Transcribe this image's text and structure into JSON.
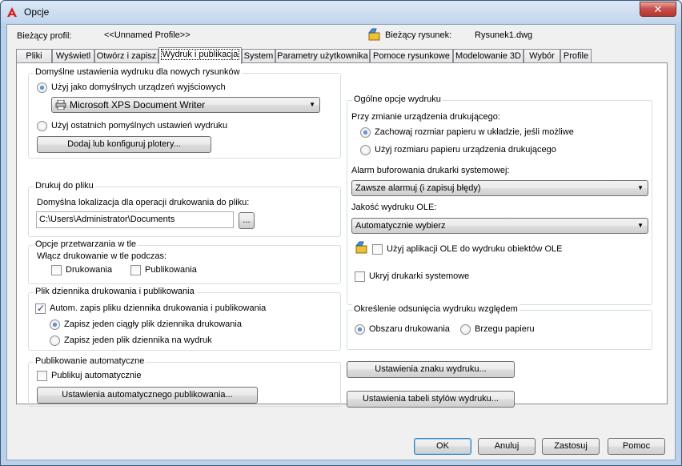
{
  "window": {
    "title": "Opcje",
    "close_symbol": "✕"
  },
  "profile": {
    "label": "Bieżący profil:",
    "value": "<<Unnamed Profile>>"
  },
  "drawing": {
    "label": "Bieżący rysunek:",
    "value": "Rysunek1.dwg",
    "icon": "drawing-file-icon"
  },
  "tabs": [
    "Pliki",
    "Wyświetl",
    "Otwórz i zapisz",
    "Wydruk i publikacja",
    "System",
    "Parametry użytkownika",
    "Pomoce rysunkowe",
    "Modelowanie 3D",
    "Wybór",
    "Profile"
  ],
  "active_tab": "Wydruk i publikacja",
  "default_print": {
    "title": "Domyślne ustawienia wydruku dla nowych rysunków",
    "use_default_device": "Użyj jako domyślnych urządzeń wyjściowych",
    "device_value": "Microsoft XPS Document Writer",
    "use_last": "Użyj ostatnich pomyślnych ustawień wydruku",
    "add_plotters_button": "Dodaj lub konfiguruj plotery..."
  },
  "print_to_file": {
    "title": "Drukuj do pliku",
    "location_label": "Domyślna lokalizacja dla operacji drukowania do pliku:",
    "path": "C:\\Users\\Administrator\\Documents",
    "browse_button": "..."
  },
  "background": {
    "title": "Opcje przetwarzania w tle",
    "subtitle": "Włącz drukowanie w tle podczas:",
    "printing": "Drukowania",
    "publishing": "Publikowania"
  },
  "log": {
    "title": "Plik dziennika drukowania i publikowania",
    "auto_save": "Autom. zapis pliku dziennika drukowania i publikowania",
    "continuous": "Zapisz jeden ciągły plik dziennika drukowania",
    "per_print": "Zapisz jeden plik dziennika na wydruk"
  },
  "auto_publish": {
    "title": "Publikowanie automatyczne",
    "checkbox": "Publikuj automatycznie",
    "settings_button": "Ustawienia automatycznego publikowania..."
  },
  "general": {
    "title": "Ogólne opcje wydruku",
    "device_change": "Przy zmianie urządzenia drukującego:",
    "keep_size": "Zachowaj rozmiar papieru w układzie, jeśli możliwe",
    "use_device_size": "Użyj rozmiaru papieru urządzenia drukującego",
    "spool_label": "Alarm buforowania drukarki systemowej:",
    "spool_value": "Zawsze alarmuj (i zapisuj błędy)",
    "ole_quality_label": "Jakość wydruku OLE:",
    "ole_quality_value": "Automatycznie wybierz",
    "ole_app": "Użyj aplikacji OLE do wydruku obiektów OLE",
    "hide_printers": "Ukryj drukarki systemowe"
  },
  "offset": {
    "title": "Określenie odsunięcia wydruku względem",
    "printable_area": "Obszaru drukowania",
    "paper_edge": "Brzegu papieru"
  },
  "stamp_button": "Ustawienia znaku wydruku...",
  "style_table_button": "Ustawienia tabeli stylów wydruku...",
  "footer": {
    "ok": "OK",
    "cancel": "Anuluj",
    "apply": "Zastosuj",
    "help": "Pomoc"
  },
  "colors": {
    "accent": "#3c7fb1",
    "titlebar": "#c2d6ec",
    "close": "#c75050"
  }
}
